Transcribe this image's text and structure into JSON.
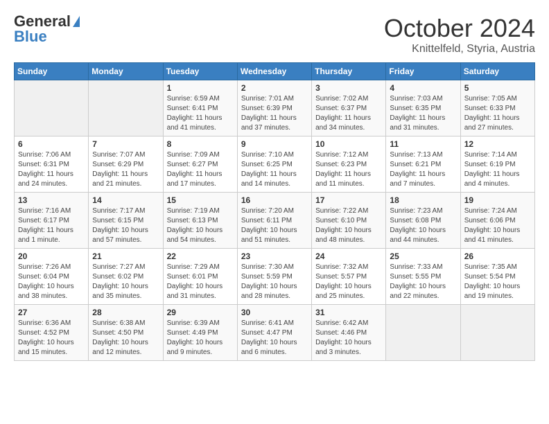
{
  "header": {
    "logo_general": "General",
    "logo_blue": "Blue",
    "month": "October 2024",
    "location": "Knittelfeld, Styria, Austria"
  },
  "days_of_week": [
    "Sunday",
    "Monday",
    "Tuesday",
    "Wednesday",
    "Thursday",
    "Friday",
    "Saturday"
  ],
  "weeks": [
    [
      {
        "num": "",
        "detail": ""
      },
      {
        "num": "",
        "detail": ""
      },
      {
        "num": "1",
        "detail": "Sunrise: 6:59 AM\nSunset: 6:41 PM\nDaylight: 11 hours and 41 minutes."
      },
      {
        "num": "2",
        "detail": "Sunrise: 7:01 AM\nSunset: 6:39 PM\nDaylight: 11 hours and 37 minutes."
      },
      {
        "num": "3",
        "detail": "Sunrise: 7:02 AM\nSunset: 6:37 PM\nDaylight: 11 hours and 34 minutes."
      },
      {
        "num": "4",
        "detail": "Sunrise: 7:03 AM\nSunset: 6:35 PM\nDaylight: 11 hours and 31 minutes."
      },
      {
        "num": "5",
        "detail": "Sunrise: 7:05 AM\nSunset: 6:33 PM\nDaylight: 11 hours and 27 minutes."
      }
    ],
    [
      {
        "num": "6",
        "detail": "Sunrise: 7:06 AM\nSunset: 6:31 PM\nDaylight: 11 hours and 24 minutes."
      },
      {
        "num": "7",
        "detail": "Sunrise: 7:07 AM\nSunset: 6:29 PM\nDaylight: 11 hours and 21 minutes."
      },
      {
        "num": "8",
        "detail": "Sunrise: 7:09 AM\nSunset: 6:27 PM\nDaylight: 11 hours and 17 minutes."
      },
      {
        "num": "9",
        "detail": "Sunrise: 7:10 AM\nSunset: 6:25 PM\nDaylight: 11 hours and 14 minutes."
      },
      {
        "num": "10",
        "detail": "Sunrise: 7:12 AM\nSunset: 6:23 PM\nDaylight: 11 hours and 11 minutes."
      },
      {
        "num": "11",
        "detail": "Sunrise: 7:13 AM\nSunset: 6:21 PM\nDaylight: 11 hours and 7 minutes."
      },
      {
        "num": "12",
        "detail": "Sunrise: 7:14 AM\nSunset: 6:19 PM\nDaylight: 11 hours and 4 minutes."
      }
    ],
    [
      {
        "num": "13",
        "detail": "Sunrise: 7:16 AM\nSunset: 6:17 PM\nDaylight: 11 hours and 1 minute."
      },
      {
        "num": "14",
        "detail": "Sunrise: 7:17 AM\nSunset: 6:15 PM\nDaylight: 10 hours and 57 minutes."
      },
      {
        "num": "15",
        "detail": "Sunrise: 7:19 AM\nSunset: 6:13 PM\nDaylight: 10 hours and 54 minutes."
      },
      {
        "num": "16",
        "detail": "Sunrise: 7:20 AM\nSunset: 6:11 PM\nDaylight: 10 hours and 51 minutes."
      },
      {
        "num": "17",
        "detail": "Sunrise: 7:22 AM\nSunset: 6:10 PM\nDaylight: 10 hours and 48 minutes."
      },
      {
        "num": "18",
        "detail": "Sunrise: 7:23 AM\nSunset: 6:08 PM\nDaylight: 10 hours and 44 minutes."
      },
      {
        "num": "19",
        "detail": "Sunrise: 7:24 AM\nSunset: 6:06 PM\nDaylight: 10 hours and 41 minutes."
      }
    ],
    [
      {
        "num": "20",
        "detail": "Sunrise: 7:26 AM\nSunset: 6:04 PM\nDaylight: 10 hours and 38 minutes."
      },
      {
        "num": "21",
        "detail": "Sunrise: 7:27 AM\nSunset: 6:02 PM\nDaylight: 10 hours and 35 minutes."
      },
      {
        "num": "22",
        "detail": "Sunrise: 7:29 AM\nSunset: 6:01 PM\nDaylight: 10 hours and 31 minutes."
      },
      {
        "num": "23",
        "detail": "Sunrise: 7:30 AM\nSunset: 5:59 PM\nDaylight: 10 hours and 28 minutes."
      },
      {
        "num": "24",
        "detail": "Sunrise: 7:32 AM\nSunset: 5:57 PM\nDaylight: 10 hours and 25 minutes."
      },
      {
        "num": "25",
        "detail": "Sunrise: 7:33 AM\nSunset: 5:55 PM\nDaylight: 10 hours and 22 minutes."
      },
      {
        "num": "26",
        "detail": "Sunrise: 7:35 AM\nSunset: 5:54 PM\nDaylight: 10 hours and 19 minutes."
      }
    ],
    [
      {
        "num": "27",
        "detail": "Sunrise: 6:36 AM\nSunset: 4:52 PM\nDaylight: 10 hours and 15 minutes."
      },
      {
        "num": "28",
        "detail": "Sunrise: 6:38 AM\nSunset: 4:50 PM\nDaylight: 10 hours and 12 minutes."
      },
      {
        "num": "29",
        "detail": "Sunrise: 6:39 AM\nSunset: 4:49 PM\nDaylight: 10 hours and 9 minutes."
      },
      {
        "num": "30",
        "detail": "Sunrise: 6:41 AM\nSunset: 4:47 PM\nDaylight: 10 hours and 6 minutes."
      },
      {
        "num": "31",
        "detail": "Sunrise: 6:42 AM\nSunset: 4:46 PM\nDaylight: 10 hours and 3 minutes."
      },
      {
        "num": "",
        "detail": ""
      },
      {
        "num": "",
        "detail": ""
      }
    ]
  ]
}
